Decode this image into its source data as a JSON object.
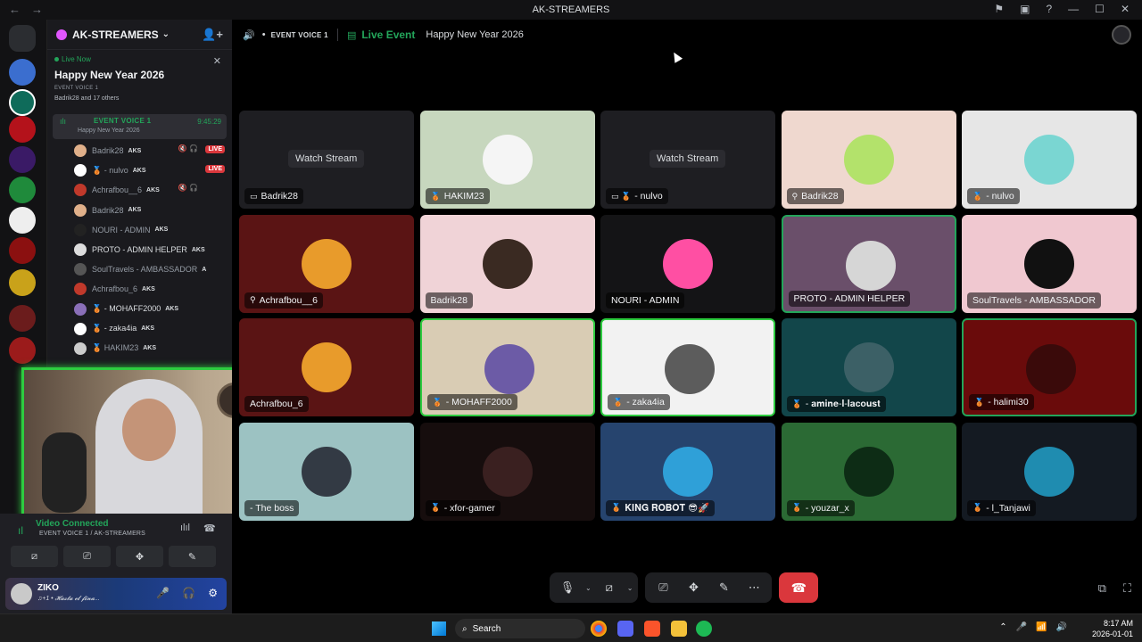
{
  "window": {
    "title": "AK-STREAMERS",
    "back": "←",
    "forward": "→",
    "icons": [
      "⚑",
      "▣",
      "?",
      "—",
      "☐",
      "✕"
    ]
  },
  "server": {
    "name": "AK-STREAMERS",
    "chevron": "⌄",
    "invite_icon": "👤+"
  },
  "event": {
    "live_now": "Live Now",
    "title": "Happy New Year 2026",
    "channel_sub": "EVENT VOICE 1",
    "users": "Badrik28 and 17 others",
    "close": "✕"
  },
  "voice_channel": {
    "name": "EVENT VOICE 1",
    "sub": "Happy New Year 2026",
    "time": "9:45:29",
    "bullet": "•"
  },
  "members": [
    {
      "name": "Badrik28",
      "tag": "AKS",
      "live": "LIVE",
      "mute": "🔇 🎧",
      "color": "#e0b08a"
    },
    {
      "name": "🥉 - nulvo",
      "tag": "AKS",
      "live": "LIVE",
      "mute": "",
      "color": "#ffffff"
    },
    {
      "name": "Achrafbou__6",
      "tag": "AKS",
      "live": "",
      "mute": "🔇 🎧",
      "color": "#c0392b"
    },
    {
      "name": "Badrik28",
      "tag": "AKS",
      "live": "",
      "mute": "",
      "color": "#e0b08a"
    },
    {
      "name": "NOURI - ADMIN",
      "tag": "AKS",
      "live": "",
      "mute": "",
      "color": "#222222"
    },
    {
      "name": "PROTO - ADMIN HELPER",
      "tag": "AKS",
      "live": "",
      "mute": "",
      "color": "#dddddd"
    },
    {
      "name": "SoulTravels - AMBASSADOR",
      "tag": "A",
      "live": "",
      "mute": "",
      "color": "#555555"
    },
    {
      "name": "Achrafbou_6",
      "tag": "AKS",
      "live": "",
      "mute": "",
      "color": "#c0392b"
    },
    {
      "name": "🥉 - MOHAFF2000",
      "tag": "AKS",
      "live": "",
      "mute": "",
      "color": "#8a6fb8"
    },
    {
      "name": "🥉 - zaka4ia",
      "tag": "AKS",
      "live": "",
      "mute": "",
      "color": "#ffffff"
    },
    {
      "name": "🥉 HAKIM23",
      "tag": "AKS",
      "live": "",
      "mute": "",
      "color": "#cccccc"
    }
  ],
  "voice_panel": {
    "status": "Video Connected",
    "channel": "EVENT VOICE 1 / AK-STREAMERS",
    "buttons": [
      "⧄",
      "⎚",
      "✥",
      "✎"
    ],
    "ic1": "ılıl",
    "ic2": "☎"
  },
  "user_panel": {
    "name": "ZIKO",
    "status": "♫+1 • 𝓗𝓪𝓼𝓽𝓪 𝓮𝓵 𝓯𝓲𝓷𝓪...",
    "mic": "🎤",
    "headset": "🎧",
    "settings": "⚙"
  },
  "main_header": {
    "speaker": "🔊",
    "channel": "EVENT VOICE 1",
    "bullet": "•",
    "calendar": "▤",
    "live_event": "Live Event",
    "event_title": "Happy New Year 2026"
  },
  "tiles": [
    {
      "label": "Badrik28",
      "icon": "▭",
      "stream": "Watch Stream",
      "bg": "#1e1e22",
      "avatar": ""
    },
    {
      "label": "HAKIM23",
      "icon": "🥉",
      "stream": "",
      "bg": "#c7d7be",
      "avatar": "#f5f5f5"
    },
    {
      "label": "- nulvo",
      "icon": "▭ 🥉",
      "stream": "Watch Stream",
      "bg": "#1e1e22",
      "avatar": ""
    },
    {
      "label": "Badrik28",
      "icon": "⚲",
      "stream": "",
      "bg": "#efd8cf",
      "avatar": "#b3e26b"
    },
    {
      "label": "- nulvo",
      "icon": "🥉",
      "stream": "",
      "bg": "#e6e6e6",
      "avatar": "#7ad6d2"
    },
    {
      "label": "Achrafbou__6",
      "icon": "⚲",
      "stream": "",
      "bg": "#5a1414",
      "avatar": "#e89b2b"
    },
    {
      "label": "Badrik28",
      "icon": "",
      "stream": "",
      "bg": "#f0d3d7",
      "avatar": "#3a2a22"
    },
    {
      "label": "NOURI - ADMIN",
      "icon": "",
      "stream": "",
      "bg": "#141416",
      "avatar": "#ff4fa3"
    },
    {
      "label": "PROTO - ADMIN HELPER",
      "icon": "",
      "stream": "",
      "bg": "#6a4f6a",
      "avatar": "#d6d6d6"
    },
    {
      "label": "SoulTravels - AMBASSADOR",
      "icon": "",
      "stream": "",
      "bg": "#f0c8d0",
      "avatar": "#111111"
    },
    {
      "label": "Achrafbou_6",
      "icon": "",
      "stream": "",
      "bg": "#5a1414",
      "avatar": "#e89b2b"
    },
    {
      "label": "- MOHAFF2000",
      "icon": "🥉",
      "stream": "",
      "bg": "#d9ccb4",
      "avatar": "#6c5ba6"
    },
    {
      "label": "- zaka4ia",
      "icon": "🥉",
      "stream": "",
      "bg": "#f2f2f2",
      "avatar": "#5c5c5c"
    },
    {
      "label": "- 𝐚𝐦𝐢𝐧𝐞-𝐥-𝐥𝐚𝐜𝐨𝐮𝐬𝐭",
      "icon": "🥉",
      "stream": "",
      "bg": "#12464a",
      "avatar": "#3c6066"
    },
    {
      "label": "- halimi30",
      "icon": "🥉",
      "stream": "",
      "bg": "#6a0b0b",
      "avatar": "#3a0a0a"
    },
    {
      "label": "- The boss",
      "icon": "",
      "stream": "",
      "bg": "#9cc2c2",
      "avatar": "#333a44"
    },
    {
      "label": "- xfor-gamer",
      "icon": "🥉",
      "stream": "",
      "bg": "#160d0d",
      "avatar": "#3a2020"
    },
    {
      "label": "𝐊𝐈𝐍𝐆 𝐑𝐎𝐁𝐎𝐓 😎🚀",
      "icon": "🥉",
      "stream": "",
      "bg": "#26446e",
      "avatar": "#2fa0d8"
    },
    {
      "label": "- youzar_x",
      "icon": "🥉",
      "stream": "",
      "bg": "#2b6a34",
      "avatar": "#0d2c15"
    },
    {
      "label": "- l_Tanjawi",
      "icon": "🥉",
      "stream": "",
      "bg": "#141a22",
      "avatar": "#1f8cb0"
    }
  ],
  "controls": {
    "mic": "🎙",
    "camera": "⧄",
    "share": "⎚",
    "activity": "✥",
    "soundboard": "✎",
    "more": "⋯",
    "hangup": "☎",
    "caret": "⌄",
    "popout": "⧉",
    "fullscreen": "⛶"
  },
  "taskbar": {
    "search": "Search",
    "time": "8:17 AM",
    "date": "2026-01-01",
    "tray": [
      "⌃",
      "🎤",
      "📶",
      "🔊"
    ]
  },
  "colors": {
    "accent_green": "#23a55a",
    "live_red": "#da373c",
    "sidebar": "#1a1a1e"
  }
}
